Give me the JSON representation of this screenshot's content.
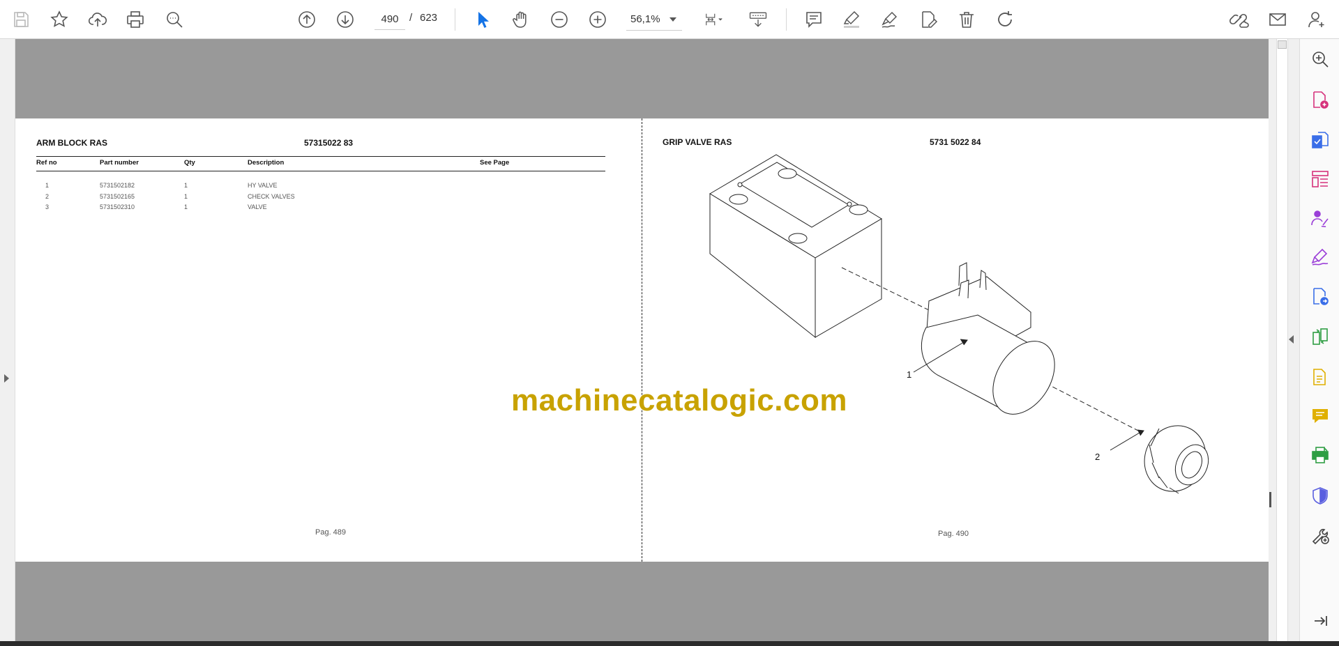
{
  "toolbar": {
    "current_page": "490",
    "page_separator": "/",
    "total_pages": "623",
    "zoom": "56,1%"
  },
  "left_page": {
    "title": "ARM BLOCK RAS",
    "code": "57315022 83",
    "headers": {
      "ref": "Ref no",
      "part": "Part number",
      "qty": "Qty",
      "desc": "Description",
      "see": "See Page"
    },
    "rows": [
      {
        "ref": "1",
        "part": "5731502182",
        "qty": "1",
        "desc": "HY VALVE"
      },
      {
        "ref": "2",
        "part": "5731502165",
        "qty": "1",
        "desc": "CHECK VALVES"
      },
      {
        "ref": "3",
        "part": "5731502310",
        "qty": "1",
        "desc": "VALVE"
      }
    ],
    "page_label": "Pag. 489"
  },
  "right_page": {
    "title": "GRIP VALVE RAS",
    "code": "5731 5022 84",
    "callouts": [
      "1",
      "2"
    ],
    "page_label": "Pag. 490"
  },
  "watermark": "machinecatalogic.com",
  "icons": {
    "toolbar": [
      "save-icon",
      "bookmark-star-icon",
      "upload-cloud-icon",
      "print-icon",
      "search-zoom-icon",
      "page-up-icon",
      "page-down-icon",
      "select-cursor-icon",
      "hand-pan-icon",
      "zoom-out-icon",
      "zoom-in-icon",
      "fit-page-icon",
      "scroll-mode-icon",
      "comment-icon",
      "highlight-icon",
      "draw-icon",
      "edit-text-icon",
      "delete-icon",
      "rotate-icon",
      "share-link-icon",
      "email-icon",
      "account-add-icon"
    ],
    "right_panel": [
      "zoom-search-icon",
      "create-pdf-icon",
      "export-pdf-icon",
      "organize-pages-icon",
      "request-signature-icon",
      "fill-sign-icon",
      "send-for-comments-icon",
      "compare-files-icon",
      "edit-pdf-icon",
      "comment-tool-icon",
      "print-production-icon",
      "protect-icon",
      "more-tools-icon",
      "collapse-panel-icon"
    ]
  },
  "colors": {
    "accent_blue": "#1473e6",
    "pink": "#d6337c",
    "blue": "#3a6ee8",
    "purple": "#9b3fd8",
    "green": "#2f9e44",
    "yellow": "#e0b000",
    "indigo": "#5a5fe0",
    "watermark": "#c8a200"
  }
}
